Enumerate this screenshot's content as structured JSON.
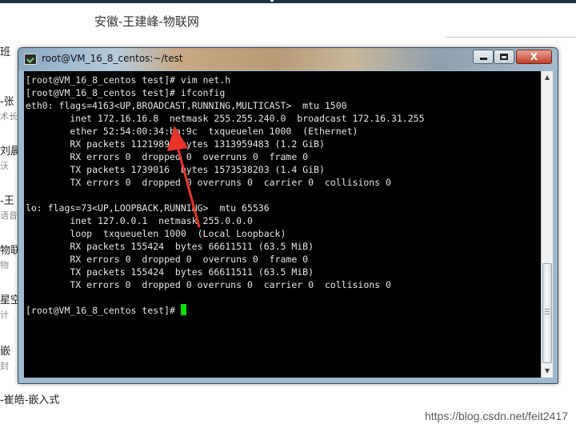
{
  "background": {
    "heading": "安徽-王建峰-物联网",
    "items": [
      {
        "title": "班",
        "sub": ""
      },
      {
        "title": "-张",
        "sub": "术长"
      },
      {
        "title": "刘晨",
        "sub": "沃"
      },
      {
        "title": "-王",
        "sub": "语音"
      },
      {
        "title": "物联",
        "sub": "物"
      },
      {
        "title": "星空",
        "sub": "计"
      },
      {
        "title": "嵌",
        "sub": "封"
      }
    ],
    "bottom_text": "-崔皓-嵌入式",
    "watermark": "https://blog.csdn.net/feit2417"
  },
  "window": {
    "title": "root@VM_16_8_centos:~/test",
    "close_label": "X"
  },
  "terminal": {
    "lines": [
      "[root@VM_16_8_centos test]# vim net.h",
      "[root@VM_16_8_centos test]# ifconfig",
      "eth0: flags=4163<UP,BROADCAST,RUNNING,MULTICAST>  mtu 1500",
      "        inet 172.16.16.8  netmask 255.255.240.0  broadcast 172.16.31.255",
      "        ether 52:54:00:34:ba:9c  txqueuelen 1000  (Ethernet)",
      "        RX packets 1121989  bytes 1313959483 (1.2 GiB)",
      "        RX errors 0  dropped 0  overruns 0  frame 0",
      "        TX packets 1739016  bytes 1573538203 (1.4 GiB)",
      "        TX errors 0  dropped 0 overruns 0  carrier 0  collisions 0",
      "",
      "lo: flags=73<UP,LOOPBACK,RUNNING>  mtu 65536",
      "        inet 127.0.0.1  netmask 255.0.0.0",
      "        loop  txqueuelen 1000  (Local Loopback)",
      "        RX packets 155424  bytes 66611511 (63.5 MiB)",
      "        RX errors 0  dropped 0  overruns 0  frame 0",
      "        TX packets 155424  bytes 66611511 (63.5 MiB)",
      "        TX errors 0  dropped 0 overruns 0  carrier 0  collisions 0",
      "",
      "[root@VM_16_8_centos test]# "
    ]
  },
  "colors": {
    "terminal_bg": "#000000",
    "terminal_fg": "#e6e6e6",
    "cursor": "#00e000",
    "annotation_arrow": "#e8332a"
  },
  "icons": {
    "window_icon": "terminal-icon",
    "arrow": "red-annotation-arrow"
  }
}
